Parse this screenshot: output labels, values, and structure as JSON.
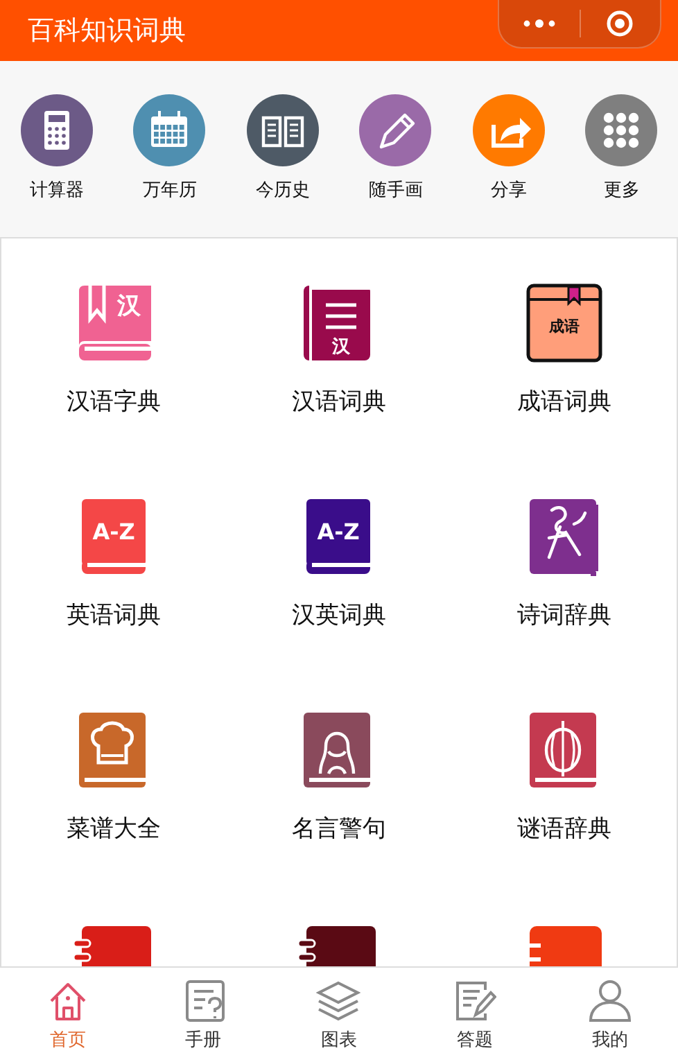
{
  "header": {
    "title": "百科知识词典"
  },
  "tools": [
    {
      "label": "计算器",
      "kind": "calculator",
      "color": "#6c5a87"
    },
    {
      "label": "万年历",
      "kind": "calendar",
      "color": "#4f8fb0"
    },
    {
      "label": "今历史",
      "kind": "book",
      "color": "#4e5a66"
    },
    {
      "label": "随手画",
      "kind": "pencil",
      "color": "#9a6aa8"
    },
    {
      "label": "分享",
      "kind": "share",
      "color": "#ff7a00"
    },
    {
      "label": "更多",
      "kind": "more",
      "color": "#7f7f7f"
    }
  ],
  "dictionaries": [
    {
      "label": "汉语字典",
      "kind": "han-bookmark",
      "color": "#f06292",
      "icon_text": "汉"
    },
    {
      "label": "汉语词典",
      "kind": "lined",
      "color": "#990a4c",
      "icon_text": "汉"
    },
    {
      "label": "成语词典",
      "kind": "bookmark",
      "color": "#ff9e7a",
      "icon_text": "成语"
    },
    {
      "label": "英语词典",
      "kind": "az",
      "color": "#f44747",
      "icon_text": "A-Z"
    },
    {
      "label": "汉英词典",
      "kind": "az",
      "color": "#3a0d8a",
      "icon_text": "A-Z"
    },
    {
      "label": "诗词辞典",
      "kind": "figure",
      "color": "#7e2f8e"
    },
    {
      "label": "菜谱大全",
      "kind": "chef",
      "color": "#c8682a"
    },
    {
      "label": "名言警句",
      "kind": "portrait",
      "color": "#8a4a5c"
    },
    {
      "label": "谜语辞典",
      "kind": "lantern",
      "color": "#c43a50"
    },
    {
      "kind": "spiral",
      "color": "#d91e18"
    },
    {
      "kind": "spiral",
      "color": "#5a0a14"
    },
    {
      "kind": "tab",
      "color": "#f03a12"
    }
  ],
  "tabs": [
    {
      "label": "首页",
      "kind": "home",
      "selected": true
    },
    {
      "label": "手册",
      "kind": "manual",
      "selected": false
    },
    {
      "label": "图表",
      "kind": "layers",
      "selected": false
    },
    {
      "label": "答题",
      "kind": "quiz",
      "selected": false
    },
    {
      "label": "我的",
      "kind": "user",
      "selected": false
    }
  ]
}
